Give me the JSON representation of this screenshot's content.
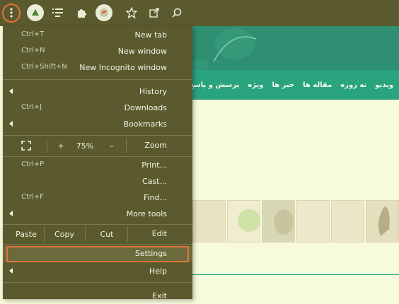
{
  "toolbar": {
    "icons": [
      "kebab-menu-icon",
      "extension-logo-icon",
      "reading-list-icon",
      "puzzle-extensions-icon",
      "profile-icon",
      "star-icon",
      "share-icon",
      "search-icon"
    ]
  },
  "menu": {
    "new_tab": {
      "label": "New tab",
      "shortcut": "Ctrl+T"
    },
    "new_window": {
      "label": "New window",
      "shortcut": "Ctrl+N"
    },
    "new_incognito": {
      "label": "New Incognito window",
      "shortcut": "Ctrl+Shift+N"
    },
    "history": {
      "label": "History"
    },
    "downloads": {
      "label": "Downloads",
      "shortcut": "Ctrl+J"
    },
    "bookmarks": {
      "label": "Bookmarks"
    },
    "zoom": {
      "label": "Zoom",
      "minus": "–",
      "value": "75%",
      "plus": "+"
    },
    "print": {
      "label": "Print...",
      "shortcut": "Ctrl+P"
    },
    "cast": {
      "label": "Cast..."
    },
    "find": {
      "label": "Find...",
      "shortcut": "Ctrl+F"
    },
    "more_tools": {
      "label": "More tools"
    },
    "edit": {
      "label": "Edit",
      "cut": "Cut",
      "copy": "Copy",
      "paste": "Paste"
    },
    "settings": {
      "label": "Settings"
    },
    "help": {
      "label": "Help"
    },
    "exit": {
      "label": "Exit"
    }
  },
  "page": {
    "nav_items": [
      "ویدیو",
      "نه روزه",
      "مقاله ها",
      "خبر ها",
      "ویژه",
      "پرسش و پاسخ"
    ]
  },
  "colors": {
    "toolbar_bg": "#5b5a2e",
    "highlight": "#e0743a",
    "nav_green": "#2aa37f"
  }
}
